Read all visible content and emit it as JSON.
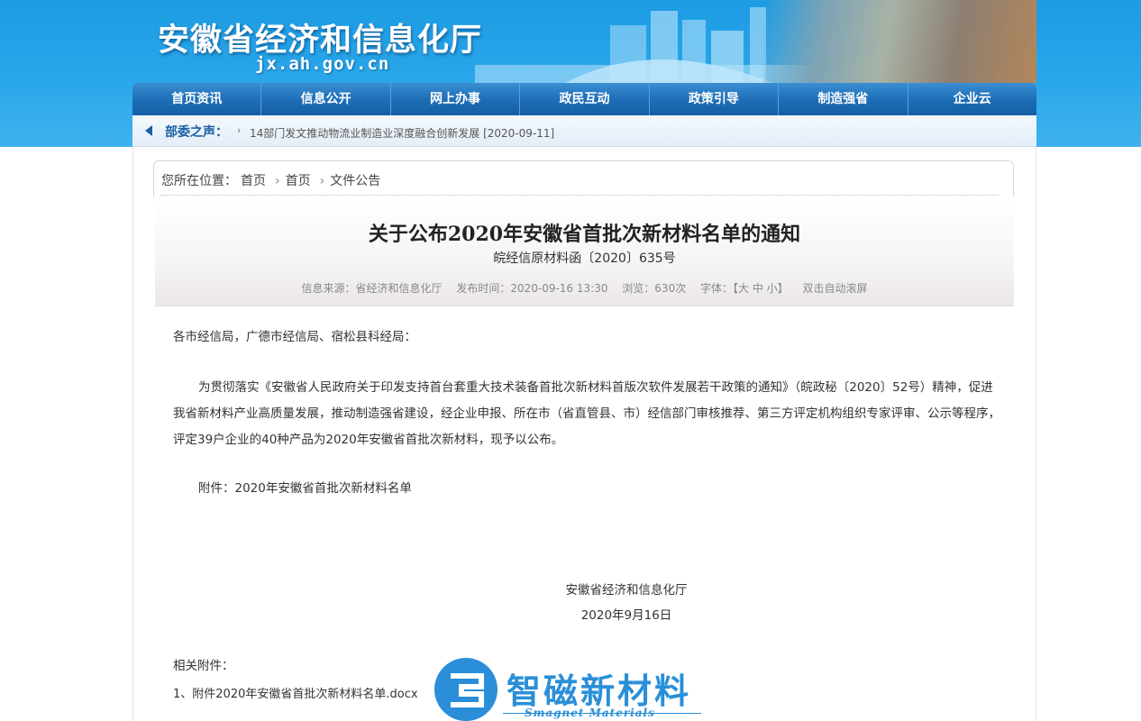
{
  "header": {
    "site_title": "安徽省经济和信息化厅",
    "site_url": "jx.ah.gov.cn"
  },
  "nav": {
    "items": [
      "首页资讯",
      "信息公开",
      "网上办事",
      "政民互动",
      "政策引导",
      "制造强省",
      "企业云"
    ]
  },
  "voice": {
    "label": "部委之声：",
    "arrow": "›",
    "link": "14部门发文推动物流业制造业深度融合创新发展 [2020-09-11]"
  },
  "breadcrumb": {
    "prefix": "您所在位置：",
    "items": [
      "首页",
      "首页",
      "文件公告"
    ]
  },
  "article": {
    "title": "关于公布2020年安徽省首批次新材料名单的通知",
    "doc_number": "皖经信原材料函〔2020〕635号",
    "meta": {
      "source": "信息来源：省经济和信息化厅",
      "time": "发布时间：2020-09-16 13:30",
      "views": "浏览：630次",
      "font_size": "字体：【大 中 小】",
      "scroll": "双击自动滚屏"
    },
    "greeting": "各市经信局，广德市经信局、宿松县科经局：",
    "body": "为贯彻落实《安徽省人民政府关于印发支持首台套重大技术装备首批次新材料首版次软件发展若干政策的通知》（皖政秘〔2020〕52号）精神，促进我省新材料产业高质量发展，推动制造强省建设，经企业申报、所在市（省直管县、市）经信部门审核推荐、第三方评定机构组织专家评审、公示等程序，评定39户企业的40种产品为2020年安徽省首批次新材料，现予以公布。",
    "attachment": "附件：2020年安徽省首批次新材料名单",
    "signature_org": "安徽省经济和信息化厅",
    "signature_date": "2020年9月16日",
    "related_title": "相关附件：",
    "related_file": "1、附件2020年安徽省首批次新材料名单.docx"
  },
  "watermark": {
    "name": "智磁新材料",
    "sub": "Smagnet Materials"
  }
}
